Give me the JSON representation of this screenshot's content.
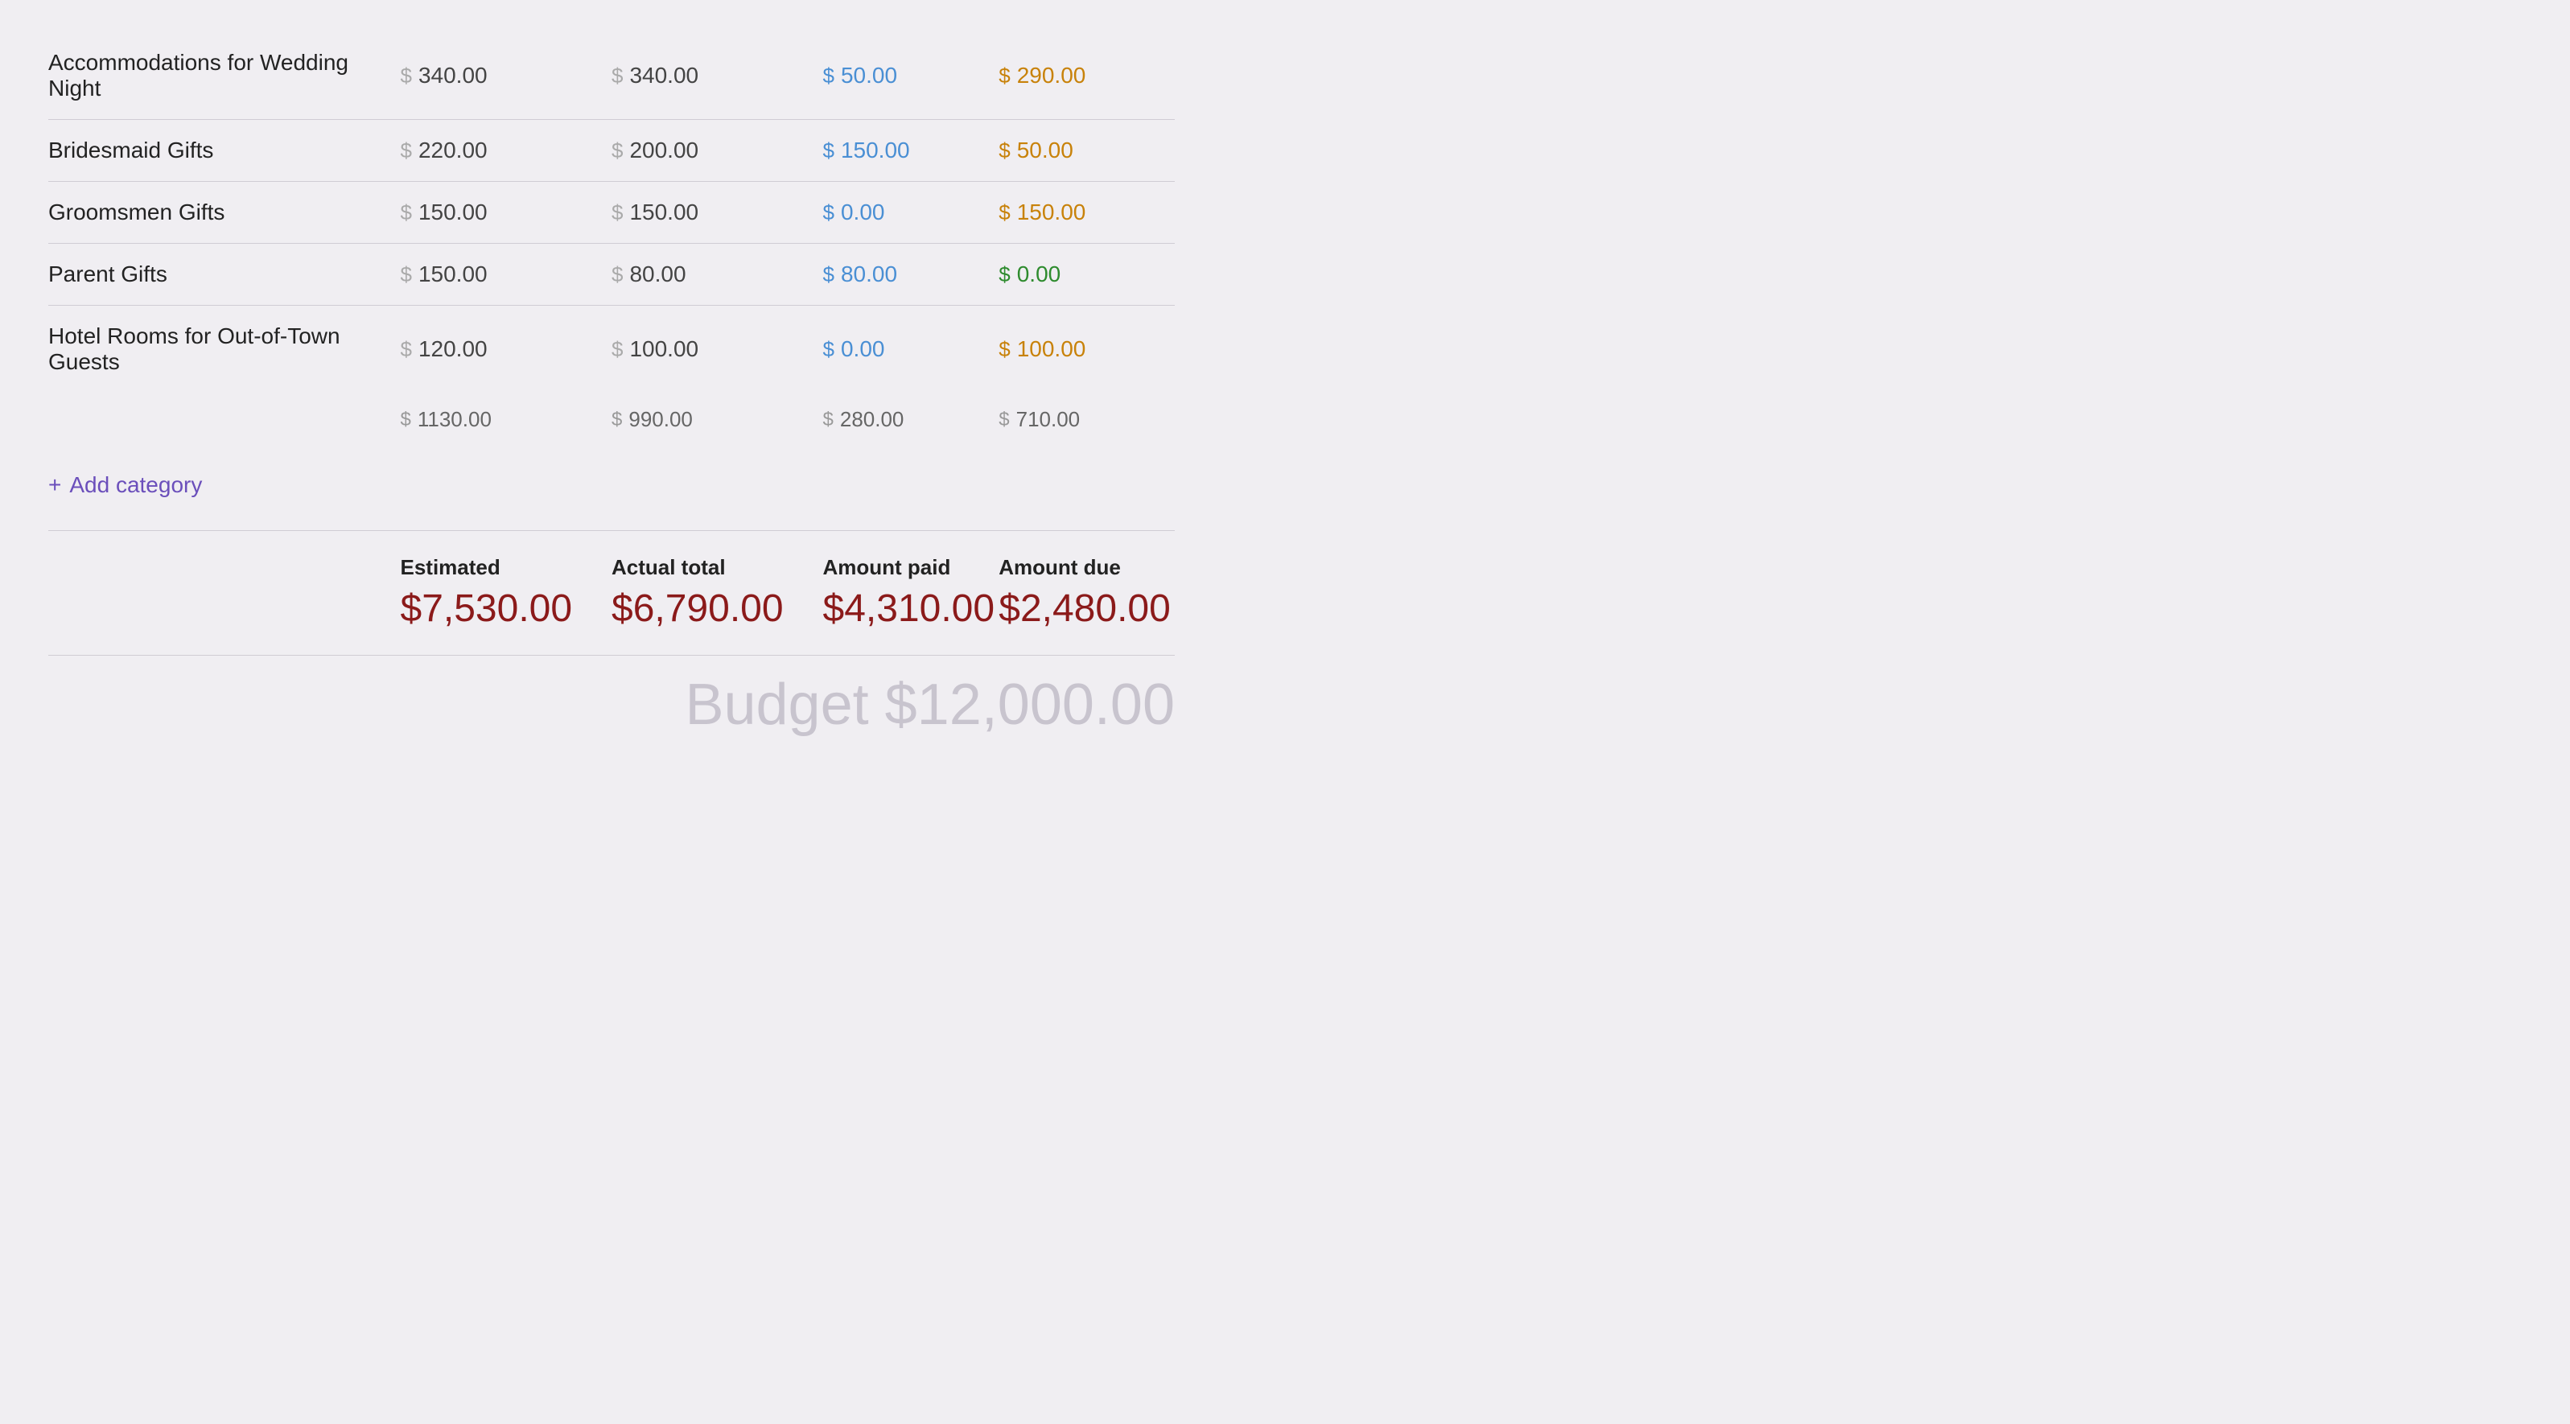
{
  "rows": [
    {
      "name": "Accommodations for Wedding Night",
      "estimated": "340.00",
      "actual": "340.00",
      "paid": "50.00",
      "due": "290.00",
      "due_color": "orange"
    },
    {
      "name": "Bridesmaid Gifts",
      "estimated": "220.00",
      "actual": "200.00",
      "paid": "150.00",
      "due": "50.00",
      "due_color": "orange"
    },
    {
      "name": "Groomsmen Gifts",
      "estimated": "150.00",
      "actual": "150.00",
      "paid": "0.00",
      "due": "150.00",
      "due_color": "orange"
    },
    {
      "name": "Parent Gifts",
      "estimated": "150.00",
      "actual": "80.00",
      "paid": "80.00",
      "due": "0.00",
      "due_color": "green"
    },
    {
      "name": "Hotel Rooms for Out-of-Town Guests",
      "estimated": "120.00",
      "actual": "100.00",
      "paid": "0.00",
      "due": "100.00",
      "due_color": "orange"
    }
  ],
  "totals": {
    "estimated": "1130.00",
    "actual": "990.00",
    "paid": "280.00",
    "due": "710.00"
  },
  "add_category_label": "Add category",
  "summary": {
    "estimated_label": "Estimated",
    "estimated_value": "$7,530.00",
    "actual_label": "Actual total",
    "actual_value": "$6,790.00",
    "paid_label": "Amount paid",
    "paid_value": "$4,310.00",
    "due_label": "Amount due",
    "due_value": "$2,480.00"
  },
  "budget_label": "Budget $12,000.00",
  "icons": {
    "plus": "+",
    "dollar": "$"
  }
}
